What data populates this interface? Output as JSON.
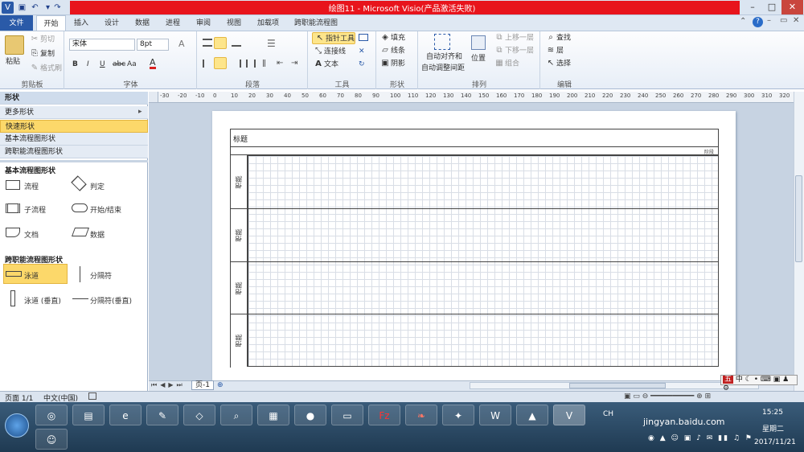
{
  "window": {
    "title": "绘图11 - Microsoft Visio(产品激活失败)"
  },
  "tabs": [
    "文件",
    "开始",
    "插入",
    "设计",
    "数据",
    "进程",
    "审阅",
    "视图",
    "加载项",
    "跨职能流程图"
  ],
  "ribbon": {
    "clipboard": {
      "paste": "粘贴",
      "cut": "剪切",
      "copy": "复制",
      "format_painter": "格式刷",
      "label": "剪贴板"
    },
    "font": {
      "name": "宋体",
      "size": "8pt",
      "bold": "B",
      "italic": "I",
      "underline": "U",
      "strike": "abc",
      "case": "Aa",
      "color": "A",
      "label": "字体",
      "grow": "A"
    },
    "paragraph": {
      "label": "段落"
    },
    "tools": {
      "pointer": "指针工具",
      "connector": "连接线",
      "text": "文本",
      "label": "工具"
    },
    "shape": {
      "fill": "填充",
      "line": "线条",
      "shadow": "阴影",
      "label": "形状"
    },
    "arrange": {
      "auto_align": "自动对齐和",
      "auto_space": "自动调整间距",
      "position": "位置",
      "bring_forward": "上移一层",
      "send_backward": "下移一层",
      "group": "组合",
      "label": "排列"
    },
    "editing": {
      "find": "查找",
      "layers": "层",
      "select": "选择",
      "label": "编辑"
    }
  },
  "shapes_panel": {
    "title": "形状",
    "more": "更多形状",
    "quick": "快速形状",
    "basic_flow": "基本流程图形状",
    "cross_func": "跨职能流程图形状",
    "section1": "基本流程图形状",
    "items1": [
      [
        "流程",
        "判定"
      ],
      [
        "子流程",
        "开始/结束"
      ],
      [
        "文档",
        "数据"
      ]
    ],
    "section2": "跨职能流程图形状",
    "items2": [
      [
        "泳道",
        "分隔符"
      ],
      [
        "泳道 (垂直)",
        "分隔符(垂直)"
      ]
    ]
  },
  "diagram": {
    "title": "标题",
    "phase": "阶段",
    "lanes": [
      "职能",
      "职能",
      "职能",
      "职能"
    ]
  },
  "page_tab": "页-1",
  "status": {
    "page": "页面 1/1",
    "lang": "中文(中国)"
  },
  "ruler_numbers": [
    "-30",
    "-20",
    "-10",
    "0",
    "10",
    "20",
    "30",
    "40",
    "50",
    "60",
    "70",
    "80",
    "90",
    "100",
    "110",
    "120",
    "130",
    "140",
    "150",
    "160",
    "170",
    "180",
    "190",
    "200",
    "210",
    "220",
    "230",
    "240",
    "250",
    "260",
    "270",
    "280",
    "290",
    "300",
    "310",
    "320"
  ],
  "tray": {
    "time": "15:25",
    "weekday": "星期二",
    "date": "2017/11/21",
    "lang": "CH",
    "watermark": "jingyan.baidu.com",
    "ime": "中"
  }
}
